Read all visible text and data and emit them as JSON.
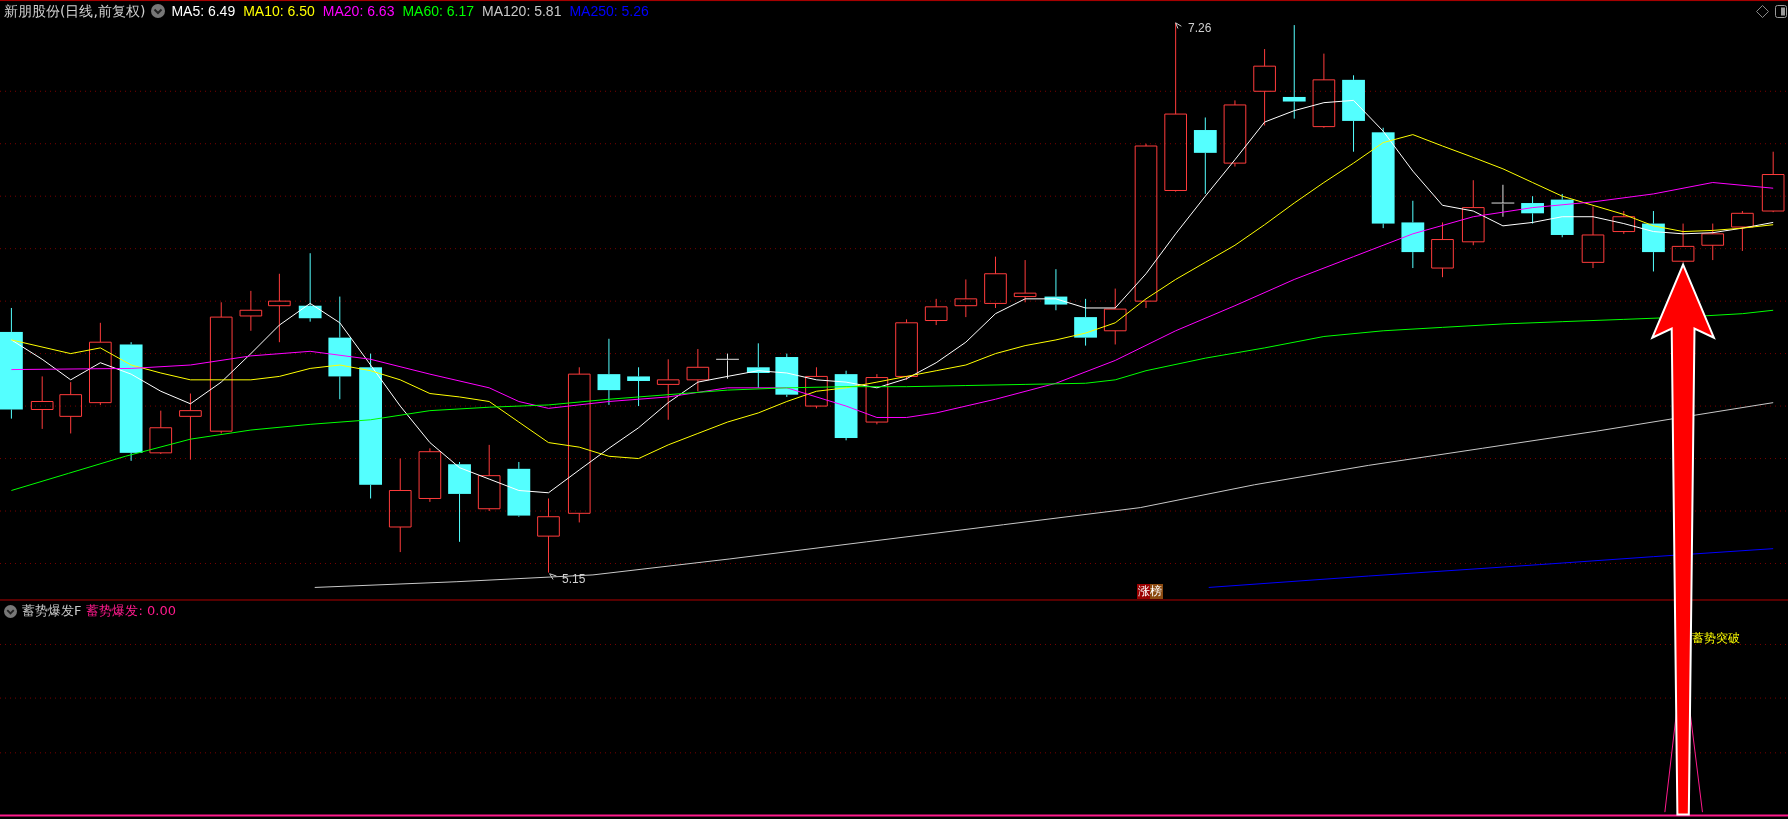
{
  "chart": {
    "stock_name": "新朋股份(日线,前复权)",
    "ma_readings": [
      {
        "label": "MA5: 6.49",
        "color": "#ffffff"
      },
      {
        "label": "MA10: 6.50",
        "color": "#ffff00"
      },
      {
        "label": "MA20: 6.63",
        "color": "#ff00ff"
      },
      {
        "label": "MA60: 6.17",
        "color": "#00ff00"
      },
      {
        "label": "MA120: 5.81",
        "color": "#c8c8c8"
      },
      {
        "label": "MA250: 5.26",
        "color": "#0000ff"
      }
    ],
    "high_label": "7.26",
    "low_label": "5.15",
    "event_badge": "涨榜"
  },
  "indicator": {
    "name": "蓄势爆发F",
    "reading": "蓄势爆发: 0.00",
    "signal_label": "蓄势突破"
  }
}
